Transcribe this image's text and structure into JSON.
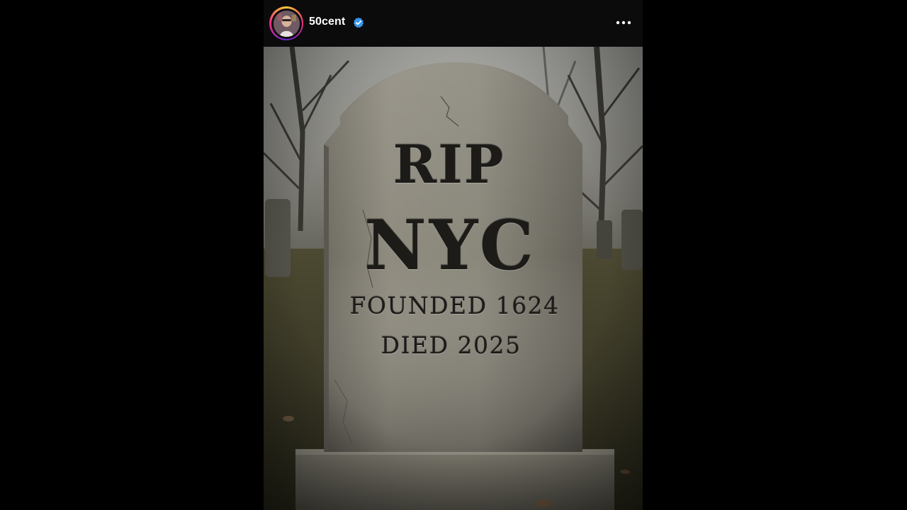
{
  "post": {
    "username": "50cent",
    "verified": true,
    "avatar_icon": "profile-avatar",
    "more_icon": "more-options-icon",
    "image": {
      "description_icon": "tombstone-photo",
      "epitaph": {
        "line1": "RIP",
        "line2": "NYC",
        "line3": "FOUNDED 1624",
        "line4": "DIED 2025"
      }
    }
  },
  "colors": {
    "background": "#000000",
    "header": "#0b0b0c",
    "username": "#ffffff",
    "verified_badge": "#3897f0"
  }
}
